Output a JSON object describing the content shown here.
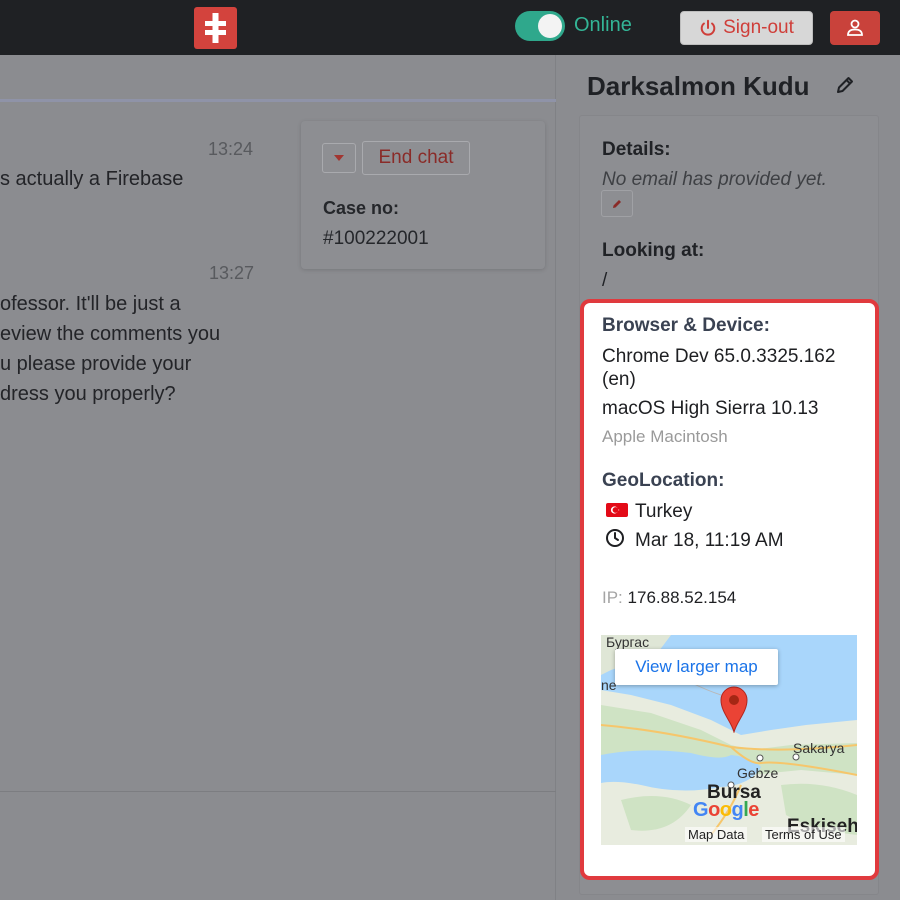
{
  "topbar": {
    "online_label": "Online",
    "signout_label": "Sign-out"
  },
  "chat": {
    "messages": [
      {
        "time": "13:24",
        "lines": [
          "s actually a Firebase"
        ]
      },
      {
        "time": "13:27",
        "lines": [
          "ofessor. It'll be just a",
          "eview the comments you",
          "u please provide your",
          "dress you properly?"
        ]
      }
    ],
    "end_chat_label": "End chat",
    "case_label": "Case no:",
    "case_value": "#100222001"
  },
  "visitor": {
    "name": "Darksalmon Kudu",
    "details_label": "Details:",
    "details_text": "No email has provided yet.",
    "looking_at_label": "Looking at:",
    "looking_at_value": "/"
  },
  "device": {
    "label": "Browser & Device:",
    "browser_line1": "Chrome Dev 65.0.3325.162",
    "browser_line2": "(en)",
    "os": "macOS High Sierra 10.13",
    "hardware": "Apple Macintosh"
  },
  "geo": {
    "label": "GeoLocation:",
    "country": "Turkey",
    "time": "Mar 18, 11:19 AM",
    "ip_label": "IP:",
    "ip_value": "176.88.52.154"
  },
  "map": {
    "button_label": "View larger map",
    "labels": {
      "burgas": "Бургас",
      "ne": "ne",
      "sakarya": "Sakarya",
      "gebze": "Gebze",
      "bursa": "Bursa",
      "eskisehir": "Eskiseh"
    },
    "google_letters": [
      "G",
      "o",
      "o",
      "g",
      "l",
      "e"
    ],
    "google_colors": [
      "#4285f4",
      "#ea4335",
      "#fbbc05",
      "#4285f4",
      "#34a853",
      "#ea4335"
    ],
    "map_data_label": "Map Data",
    "terms_label": "Terms of Use"
  },
  "icons": {
    "logo": "medical-cross-icon",
    "signout": "power-icon",
    "profile": "user-icon",
    "edit": "pencil-icon",
    "clock": "clock-icon",
    "flag": "turkey-flag-icon",
    "pin": "map-pin-icon"
  },
  "colors": {
    "accent_red": "#e03a3e",
    "online_green": "#33b596",
    "link_blue": "#1a73e8"
  }
}
